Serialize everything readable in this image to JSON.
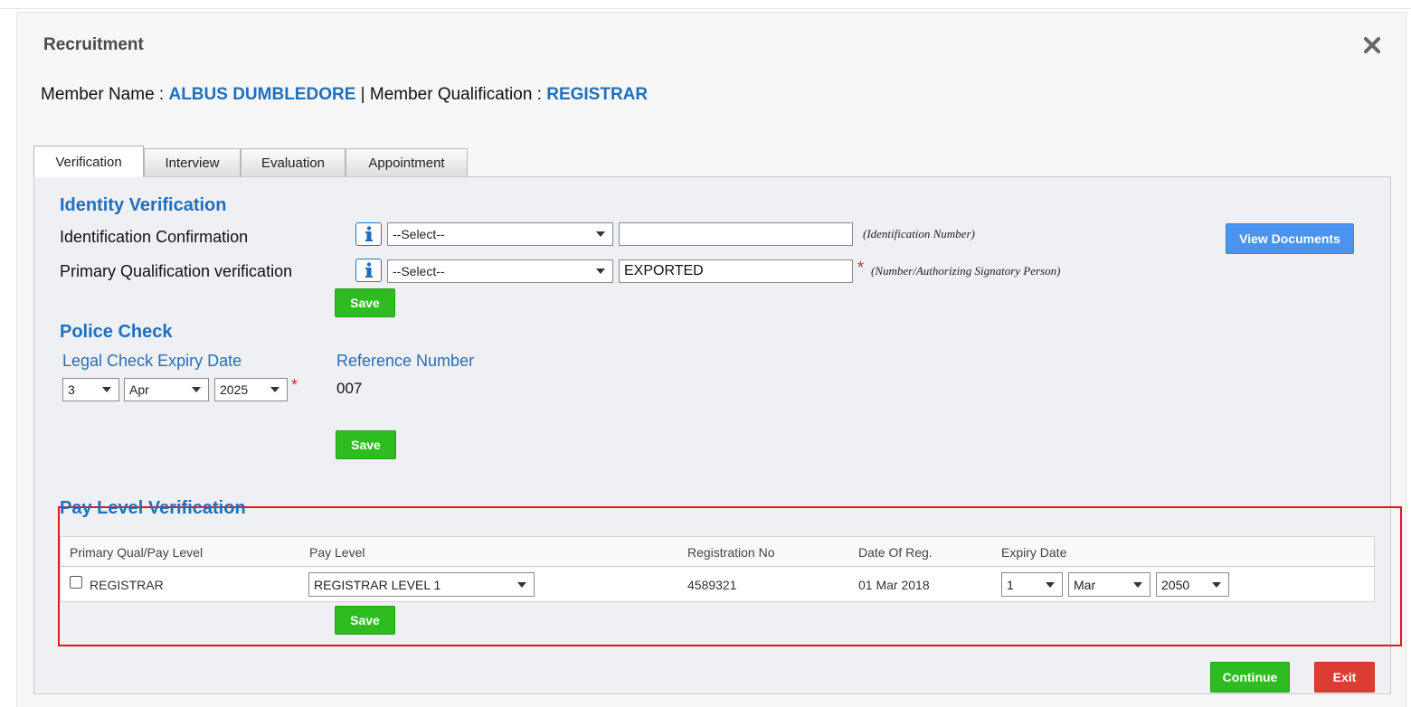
{
  "modal": {
    "title": "Recruitment",
    "close_icon": "close-icon"
  },
  "member": {
    "name_label": "Member Name :",
    "name_value": "ALBUS DUMBLEDORE",
    "separator": "|",
    "qual_label": "Member Qualification :",
    "qual_value": "REGISTRAR"
  },
  "tabs": [
    {
      "label": "Verification",
      "active": true
    },
    {
      "label": "Interview",
      "active": false
    },
    {
      "label": "Evaluation",
      "active": false
    },
    {
      "label": "Appointment",
      "active": false
    }
  ],
  "identity": {
    "title": "Identity Verification",
    "row1": {
      "label": "Identification Confirmation",
      "select_value": "--Select--",
      "input_value": "",
      "hint": "(Identification Number)"
    },
    "row2": {
      "label": "Primary Qualification verification",
      "select_value": "--Select--",
      "input_value": "EXPORTED",
      "required": "*",
      "hint": "(Number/Authorizing Signatory Person)"
    },
    "view_documents_label": "View Documents",
    "save_label": "Save"
  },
  "police": {
    "title": "Police Check",
    "expiry_label": "Legal Check Expiry Date",
    "day": "3",
    "month": "Apr",
    "year": "2025",
    "required": "*",
    "reference_label": "Reference Number",
    "reference_value": "007",
    "save_label": "Save"
  },
  "pay_level": {
    "title": "Pay Level Verification",
    "columns": [
      "Primary Qual/Pay Level",
      "Pay Level",
      "Registration No",
      "Date Of Reg.",
      "Expiry Date"
    ],
    "row": {
      "qual": "REGISTRAR",
      "checked": false,
      "pay_level": "REGISTRAR LEVEL 1",
      "registration_no": "4589321",
      "date_of_reg": "01 Mar 2018",
      "expiry_day": "1",
      "expiry_month": "Mar",
      "expiry_year": "2050"
    },
    "save_label": "Save"
  },
  "footer": {
    "continue_label": "Continue",
    "exit_label": "Exit"
  },
  "colors": {
    "accent_blue": "#1f6fbf",
    "save_green": "#2ebd21",
    "exit_red": "#dc3d32",
    "highlight_red": "#e8161b",
    "view_docs_blue": "#4a94f0"
  }
}
